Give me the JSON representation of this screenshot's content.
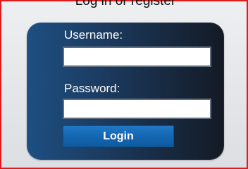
{
  "header": {
    "partial_text": "Log in or register"
  },
  "login_form": {
    "username_label": "Username:",
    "username_value": "",
    "password_label": "Password:",
    "password_value": "",
    "login_button": "Login"
  },
  "colors": {
    "frame_border": "#e01b1b",
    "panel_left": "#1d4f82",
    "panel_right": "#141a24",
    "button": "#1668b3"
  }
}
